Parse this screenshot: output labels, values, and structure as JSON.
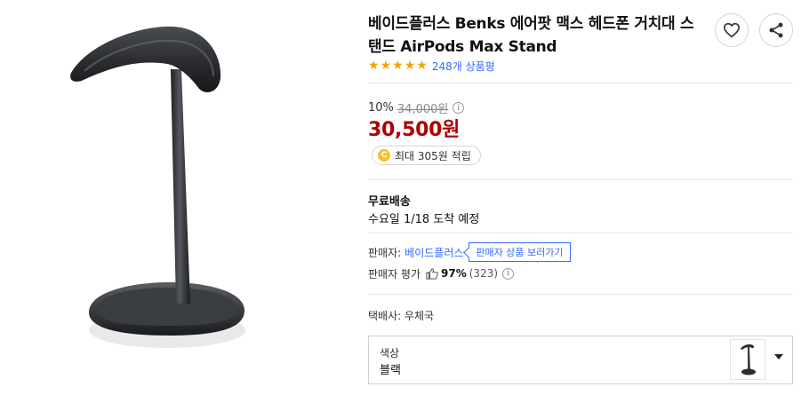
{
  "product": {
    "title": "베이드플러스 Benks 에어팟 맥스 헤드폰 거치대 스탠드 AirPods Max Stand",
    "rating_stars": 5,
    "review_count": "248개 상품평"
  },
  "icons": {
    "wishlist": "heart-icon",
    "share": "share-icon",
    "info": "info-icon",
    "thumb": "thumbs-up-icon",
    "dropdown": "chevron-down-icon"
  },
  "price": {
    "discount_rate": "10%",
    "original_price": "34,000원",
    "sale_price": "30,500원",
    "info_glyph": "i"
  },
  "reward": {
    "coin_glyph": "C",
    "text": "최대 305원 적립"
  },
  "shipping": {
    "title": "무료배송",
    "arrival": "수요일 1/18 도착 예정"
  },
  "seller": {
    "label": "판매자:",
    "name": "베이드플러스",
    "view_products_button": "판매자 상품 보러가기",
    "rating_label": "판매자 평가",
    "rating_percent": "97%",
    "rating_count": "(323)",
    "info_glyph": "i"
  },
  "courier": {
    "text": "택배사: 우체국"
  },
  "option": {
    "label": "색상",
    "value": "블랙"
  },
  "colors": {
    "price_red": "#ae0000",
    "link_blue": "#346aff",
    "star_orange": "#f5a300",
    "product_dark": "#2b2d31",
    "coin_yellow": "#f7c325"
  }
}
